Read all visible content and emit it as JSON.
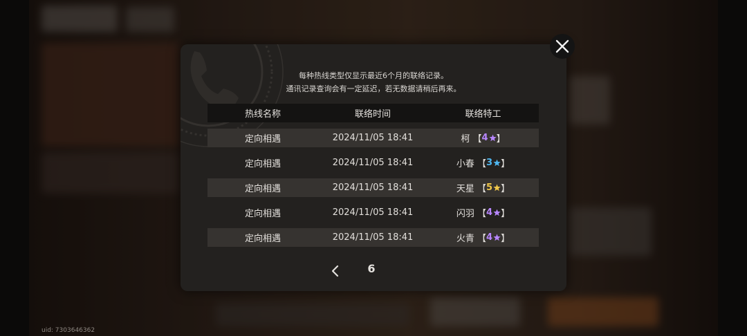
{
  "uid": "uid: 7303646362",
  "dialog": {
    "notice_line1": "每种热线类型仅显示最近6个月的联络记录。",
    "notice_line2": "通讯记录查询会有一定延迟，若无数据请稍后再来。",
    "columns": [
      "热线名称",
      "联络时间",
      "联络特工"
    ],
    "rows": [
      {
        "hotline": "定向相遇",
        "time": "2024/11/05 18:41",
        "agent": "柯",
        "rank": "4",
        "rank_color": "#b786ff"
      },
      {
        "hotline": "定向相遇",
        "time": "2024/11/05 18:41",
        "agent": "小春",
        "rank": "3",
        "rank_color": "#4fb6ef"
      },
      {
        "hotline": "定向相遇",
        "time": "2024/11/05 18:41",
        "agent": "天星",
        "rank": "5",
        "rank_color": "#f1c84a"
      },
      {
        "hotline": "定向相遇",
        "time": "2024/11/05 18:41",
        "agent": "闪羽",
        "rank": "4",
        "rank_color": "#b786ff"
      },
      {
        "hotline": "定向相遇",
        "time": "2024/11/05 18:41",
        "agent": "火青",
        "rank": "4",
        "rank_color": "#b786ff"
      }
    ],
    "bracket_open": "【",
    "bracket_close": "】",
    "page": "6",
    "icons": {
      "prev": "chevron-left-icon",
      "close": "close-icon",
      "star": "star-icon",
      "watermark": "telephone-icon"
    }
  }
}
